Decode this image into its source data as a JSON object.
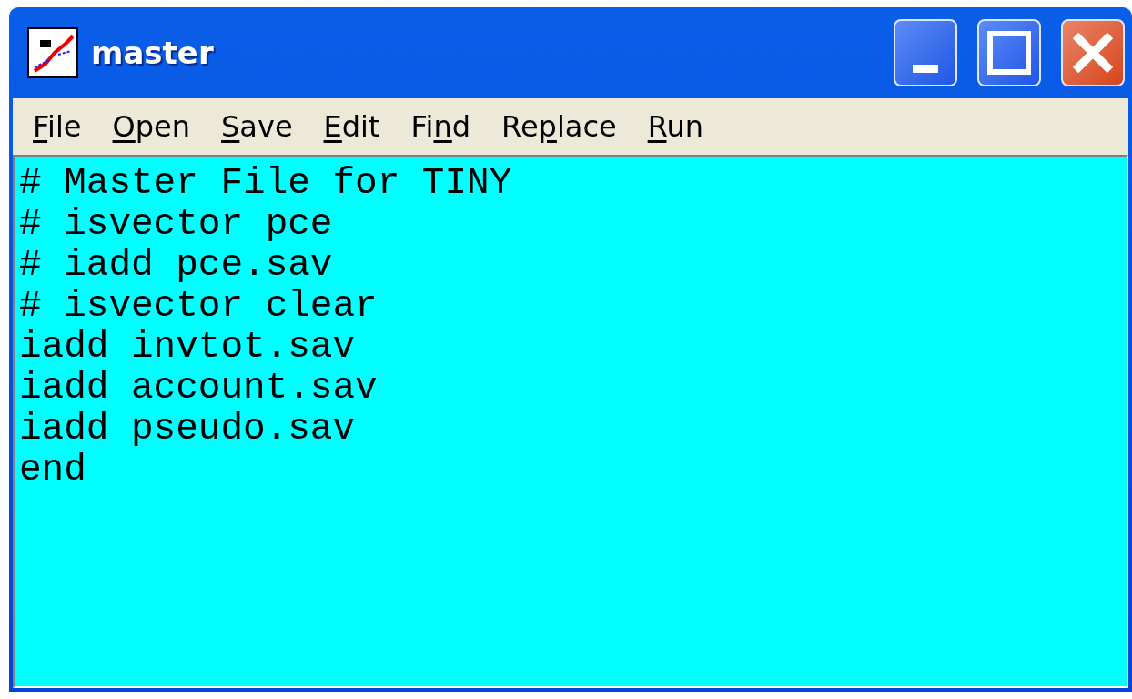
{
  "window": {
    "title": "master"
  },
  "menu": [
    {
      "key": "F",
      "post": "ile"
    },
    {
      "key": "O",
      "post": "pen"
    },
    {
      "key": "S",
      "post": "ave"
    },
    {
      "key": "E",
      "post": "dit"
    },
    {
      "pre": "Fi",
      "key": "n",
      "post": "d"
    },
    {
      "pre": "Re",
      "key": "p",
      "post": "lace"
    },
    {
      "key": "R",
      "post": "un"
    }
  ],
  "editor": {
    "lines": [
      "# Master File for TINY",
      "# isvector pce",
      "# iadd pce.sav",
      "# isvector clear",
      "iadd invtot.sav",
      "iadd account.sav",
      "iadd pseudo.sav",
      "end"
    ]
  }
}
